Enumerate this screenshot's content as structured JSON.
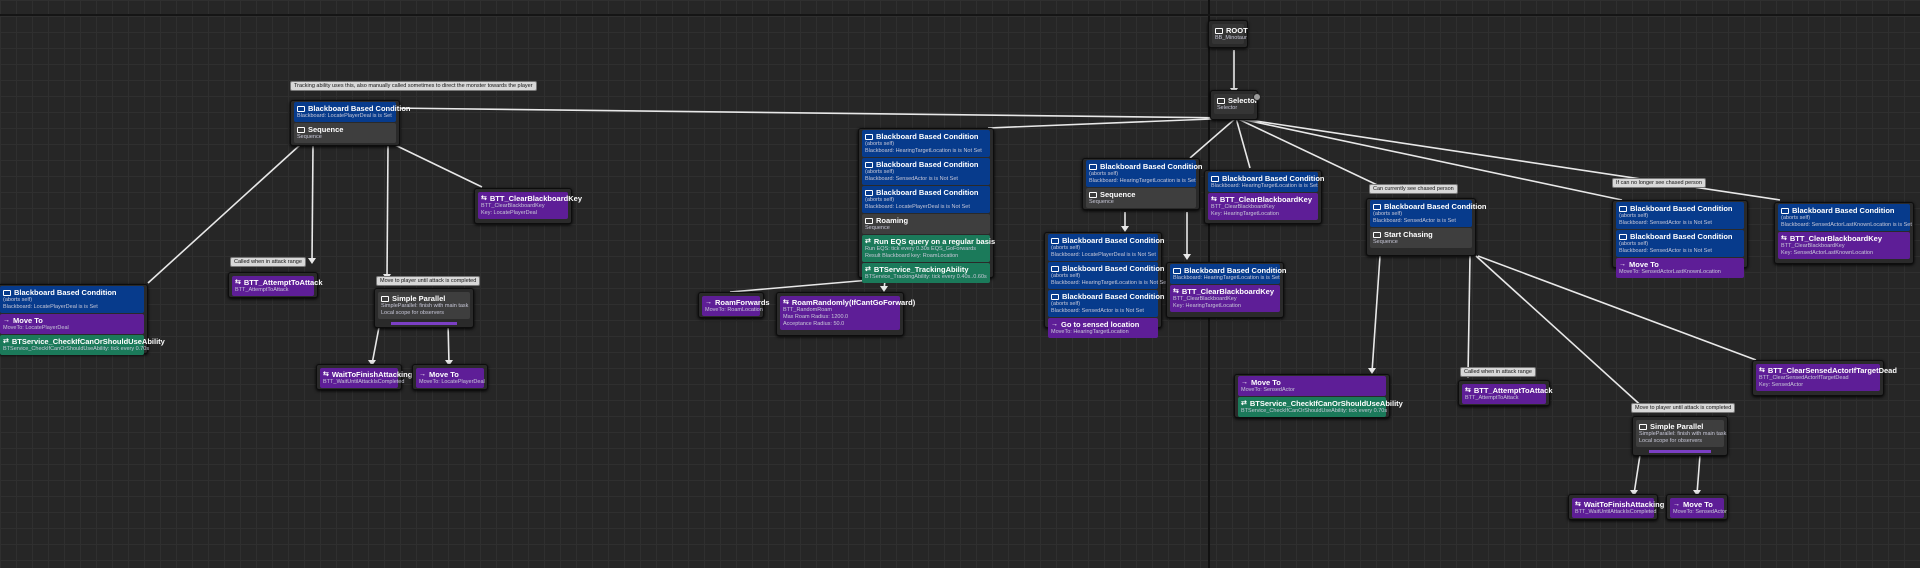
{
  "nodes": {
    "root": {
      "title": "ROOT",
      "sub": "BB_Minotaur"
    },
    "selector": {
      "title": "Selector",
      "sub": "Selector"
    },
    "a_seq": {
      "dec_title": "Blackboard Based Condition",
      "dec_sub": "Blackboard: LocatePlayerDeal is is Set",
      "title": "Sequence",
      "sub": "Sequence"
    },
    "a_clear": {
      "title": "BTT_ClearBlackboardKey",
      "sub1": "BTT_ClearBlackboardKey",
      "sub2": "Key: LocatePlayerDeal"
    },
    "a_moveto": {
      "dec_title": "Blackboard Based Condition",
      "dec_sub1": "(aborts self)",
      "dec_sub2": "Blackboard: LocatePlayerDeal is is Set",
      "title": "Move To",
      "sub": "MoveTo: LocatePlayerDeal",
      "svc_title": "BTService_CheckIfCanOrShouldUseAbility",
      "svc_sub": "BTService_CheckIfCanOrShouldUseAbility: tick every 0.70s"
    },
    "a_attempt": {
      "title": "BTT_AttemptToAttack",
      "sub": "BTT_AttemptToAttack"
    },
    "a_parallel": {
      "title": "Simple Parallel",
      "sub1": "SimpleParallel: finish with main task",
      "sub2": "Local scope for observers"
    },
    "a_wait": {
      "title": "WaitToFinishAttacking",
      "sub": "BTT_WaitUntilAttackIsCompleted"
    },
    "a_move2": {
      "title": "Move To",
      "sub": "MoveTo: LocatePlayerDeal"
    },
    "b_roam": {
      "dec": [
        {
          "title": "Blackboard Based Condition",
          "sub1": "(aborts self)",
          "sub2": "Blackboard: HearingTargetLocation is is Not Set"
        },
        {
          "title": "Blackboard Based Condition",
          "sub1": "(aborts self)",
          "sub2": "Blackboard: SensedActor is is Not Set"
        },
        {
          "title": "Blackboard Based Condition",
          "sub1": "(aborts self)",
          "sub2": "Blackboard: LocatePlayerDeal is is Not Set"
        }
      ],
      "title": "Roaming",
      "sub": "Sequence",
      "svc1_title": "Run EQS query on a regular basis",
      "svc1_sub1": "Run EQS: tick every 0.30s  EQS_GoForwards",
      "svc1_sub2": "Result Blackboard key: RoamLocation",
      "svc2_title": "BTService_TrackingAbility",
      "svc2_sub": "BTService_TrackingAbility: tick every 0.40s..0.60s"
    },
    "b_forwards": {
      "title": "RoamForwards",
      "sub": "MoveTo: RoamLocation"
    },
    "b_random": {
      "title": "RoamRandomly(IfCantGoForward)",
      "sub1": "BTT_RandomRoam",
      "sub2": "Max Roam Radius: 1200.0",
      "sub3": "Acceptance Radius: 50.0"
    },
    "c_seq": {
      "dec_title": "Blackboard Based Condition",
      "dec_sub1": "(aborts self)",
      "dec_sub2": "Blackboard: HearingTargetLocation is is Set",
      "title": "Sequence",
      "sub": "Sequence"
    },
    "c_clear": {
      "title": "Blackboard Based Condition",
      "sub": "Blackboard: HearingTargetLocation is is Set",
      "t2": "BTT_ClearBlackboardKey",
      "t2sub1": "BTT_ClearBlackboardKey",
      "t2sub2": "Key: HearingTargetLocation"
    },
    "c_goto": {
      "dec": [
        {
          "title": "Blackboard Based Condition",
          "sub1": "(aborts self)",
          "sub2": "Blackboard: LocatePlayerDeal is is Not Set"
        },
        {
          "title": "Blackboard Based Condition",
          "sub1": "(aborts self)",
          "sub2": "Blackboard: HearingTargetLocation is is Not Set"
        },
        {
          "title": "Blackboard Based Condition",
          "sub1": "(aborts self)",
          "sub2": "Blackboard: SensedActor is is Not Set"
        }
      ],
      "title": "Go to sensed location",
      "sub": "MoveTo: HearingTargetLocation"
    },
    "c_clear2": {
      "dec_title": "Blackboard Based Condition",
      "dec_sub": "Blackboard: HearingTargetLocation is is Set",
      "title": "BTT_ClearBlackboardKey",
      "sub1": "BTT_ClearBlackboardKey",
      "sub2": "Key: HearingTargetLocation"
    },
    "d_chase": {
      "dec_title": "Blackboard Based Condition",
      "dec_sub1": "(aborts self)",
      "dec_sub2": "Blackboard: SensedActor is is Set",
      "title": "Start Chasing",
      "sub": "Sequence"
    },
    "d_moveto": {
      "title": "Move To",
      "sub": "MoveTo: SensedActor",
      "svc_title": "BTService_CheckIfCanOrShouldUseAbility",
      "svc_sub": "BTService_CheckIfCanOrShouldUseAbility: tick every 0.70s"
    },
    "d_attempt": {
      "title": "BTT_AttemptToAttack",
      "sub": "BTT_AttemptToAttack"
    },
    "d_parallel": {
      "title": "Simple Parallel",
      "sub1": "SimpleParallel: finish with main task",
      "sub2": "Local scope for observers"
    },
    "d_wait": {
      "title": "WaitToFinishAttacking",
      "sub": "BTT_WaitUntilAttackIsCompleted"
    },
    "d_move2": {
      "title": "Move To",
      "sub": "MoveTo: SensedActor"
    },
    "d_clearsensed": {
      "title": "BTT_ClearSensedActorIfTargetDead",
      "sub1": "BTT_ClearSensedActorIfTargetDead",
      "sub2": "Key: SensedActor"
    },
    "e_lost": {
      "dec": [
        {
          "title": "Blackboard Based Condition",
          "sub1": "(aborts self)",
          "sub2": "Blackboard: SensedActor is is Not Set"
        },
        {
          "title": "Blackboard Based Condition",
          "sub1": "(aborts self)",
          "sub2": "Blackboard: SensedActor is is Not Set"
        }
      ],
      "title": "Move To",
      "sub": "MoveTo: SensedActorLastKnownLocation",
      "t2": "BTT_ClearBlackboardKey",
      "t2sub": "BTT_ClearBlackboardKey"
    },
    "f_clear": {
      "dec_title": "Blackboard Based Condition",
      "dec_sub1": "(aborts self)",
      "dec_sub2": "Blackboard: SensedActorLastKnownLocation is is Set",
      "title": "BTT_ClearBlackboardKey",
      "sub1": "BTT_ClearBlackboardKey",
      "sub2": "Key: SensedActorLastKnownLocation"
    }
  },
  "comments": {
    "tracking": "Tracking ability uses this, also manually called sometimes to direct the monster towards the player",
    "called_a": "Called when in attack range",
    "move_a": "Move to player until attack is completed",
    "chase": "Can currently see chased person",
    "lost": "If can no longer see chased person",
    "called_d": "Called when in attack range",
    "move_d": "Move to player until attack is completed"
  },
  "colors": {
    "decorator": "#073b8c",
    "task": "#5e1e97",
    "service": "#1b7a5a",
    "composite": "#3e3e3e",
    "background": "#262626"
  }
}
